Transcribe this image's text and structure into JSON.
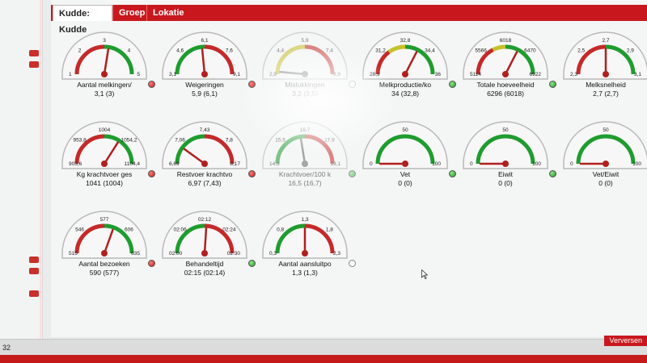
{
  "tabs": [
    {
      "label": "Kudde: Kudde",
      "active": true
    },
    {
      "label": "Groep",
      "active": false
    },
    {
      "label": "Lokatie",
      "active": false
    }
  ],
  "gauges": [
    {
      "label": "Aantal melkingen/",
      "value": "3,1 (3)",
      "ticks": [
        "1",
        "2",
        "3",
        "4",
        "5"
      ],
      "status": "red",
      "zones": [
        [
          "#c52a2a",
          0,
          0.5
        ],
        [
          "#1f9c2f",
          0.5,
          1
        ]
      ],
      "needle": 0.55,
      "faded": false
    },
    {
      "label": "Weigeringen",
      "value": "5,9 (6,1)",
      "ticks": [
        "3,1",
        "4,6",
        "6,1",
        "7,6",
        "9,1"
      ],
      "status": "red",
      "zones": [
        [
          "#1f9c2f",
          0,
          0.5
        ],
        [
          "#c52a2a",
          0.5,
          1
        ]
      ],
      "needle": 0.47,
      "faded": false
    },
    {
      "label": "Mislukkingen",
      "value": "3,2 (3,5)",
      "ticks": [
        "2,9",
        "4,4",
        "5,9",
        "7,4",
        "8,9"
      ],
      "status": "gray",
      "zones": [
        [
          "#c8c02a",
          0,
          0.5
        ],
        [
          "#c52a2a",
          0.5,
          1
        ]
      ],
      "needle": 0.03,
      "faded": true
    },
    {
      "label": "Melkproductie/ko",
      "value": "34 (32,8)",
      "ticks": [
        "28,9",
        "31,2",
        "32,8",
        "34,4",
        "36"
      ],
      "status": "green",
      "zones": [
        [
          "#c52a2a",
          0,
          0.3
        ],
        [
          "#c8c02a",
          0.3,
          0.5
        ],
        [
          "#1f9c2f",
          0.5,
          1
        ]
      ],
      "needle": 0.65,
      "faded": false
    },
    {
      "label": "Totale hoeveelheid",
      "value": "6296 (6018)",
      "ticks": [
        "5114",
        "5566",
        "6018",
        "6470",
        "6922"
      ],
      "status": "green",
      "zones": [
        [
          "#c52a2a",
          0,
          0.35
        ],
        [
          "#c8c02a",
          0.35,
          0.5
        ],
        [
          "#1f9c2f",
          0.5,
          1
        ]
      ],
      "needle": 0.65,
      "faded": false
    },
    {
      "label": "Melksnelheid",
      "value": "2,7 (2,7)",
      "ticks": [
        "2,3",
        "2,5",
        "2,7",
        "2,9",
        "3,1"
      ],
      "status": "green",
      "zones": [
        [
          "#c52a2a",
          0,
          0.5
        ],
        [
          "#1f9c2f",
          0.5,
          1
        ]
      ],
      "needle": 0.5,
      "faded": false
    },
    {
      "label": "Kg krachtvoer ges",
      "value": "1041 (1004)",
      "ticks": [
        "903,6",
        "953,8",
        "1004",
        "1054,2",
        "1104,4"
      ],
      "status": "red",
      "zones": [
        [
          "#c52a2a",
          0,
          0.5
        ],
        [
          "#1f9c2f",
          0.5,
          1
        ]
      ],
      "needle": 0.68,
      "faded": false
    },
    {
      "label": "Restvoer krachtvo",
      "value": "6,97 (7,43)",
      "ticks": [
        "6,69",
        "7,06",
        "7,43",
        "7,8",
        "8,17"
      ],
      "status": "red",
      "zones": [
        [
          "#1f9c2f",
          0,
          0.5
        ],
        [
          "#c52a2a",
          0.5,
          1
        ]
      ],
      "needle": 0.2,
      "faded": false
    },
    {
      "label": "Krachtvoer/100 k",
      "value": "16,5 (16,7)",
      "ticks": [
        "14,3",
        "15,5",
        "16,7",
        "17,9",
        "19,1"
      ],
      "status": "green",
      "zones": [
        [
          "#1f9c2f",
          0,
          0.5
        ],
        [
          "#c52a2a",
          0.5,
          1
        ]
      ],
      "needle": 0.45,
      "faded": true
    },
    {
      "label": "Vet",
      "value": "0 (0)",
      "ticks": [
        "0",
        "50",
        "100"
      ],
      "status": "green",
      "zones": [
        [
          "#1f9c2f",
          0,
          1
        ]
      ],
      "needle": 0.0,
      "faded": false
    },
    {
      "label": "Eiwit",
      "value": "0 (0)",
      "ticks": [
        "0",
        "50",
        "100"
      ],
      "status": "green",
      "zones": [
        [
          "#1f9c2f",
          0,
          1
        ]
      ],
      "needle": 0.0,
      "faded": false
    },
    {
      "label": "Vet/Eiwit",
      "value": "0 (0)",
      "ticks": [
        "0",
        "50",
        "100"
      ],
      "status": "green",
      "zones": [
        [
          "#1f9c2f",
          0,
          1
        ]
      ],
      "needle": 0.0,
      "faded": false
    },
    {
      "label": "Aantal bezoeken",
      "value": "590 (577)",
      "ticks": [
        "515",
        "546",
        "577",
        "606",
        "635"
      ],
      "status": "red",
      "zones": [
        [
          "#c52a2a",
          0,
          0.5
        ],
        [
          "#1f9c2f",
          0.5,
          1
        ]
      ],
      "needle": 0.61,
      "faded": false
    },
    {
      "label": "Behandeltijd",
      "value": "02:15 (02:14)",
      "ticks": [
        "02:00",
        "02:06",
        "02:12",
        "02:24",
        "02:30"
      ],
      "status": "green",
      "zones": [
        [
          "#1f9c2f",
          0,
          0.5
        ],
        [
          "#c52a2a",
          0.5,
          1
        ]
      ],
      "needle": 0.52,
      "faded": false
    },
    {
      "label": "Aantal aansluitpo",
      "value": "1,3 (1,3)",
      "ticks": [
        "0,3",
        "0,8",
        "1,3",
        "1,8",
        "2,3"
      ],
      "status": "gray",
      "zones": [
        [
          "#1f9c2f",
          0,
          0.5
        ],
        [
          "#c52a2a",
          0.5,
          1
        ]
      ],
      "needle": 0.5,
      "faded": false
    }
  ],
  "footer": {
    "number": "32",
    "refresh_label": "Verversen"
  },
  "colors": {
    "brand_red": "#c8181e",
    "ok_green": "#1f9c2f",
    "warn_yellow": "#c8c02a",
    "alert_red": "#c52a2a"
  }
}
